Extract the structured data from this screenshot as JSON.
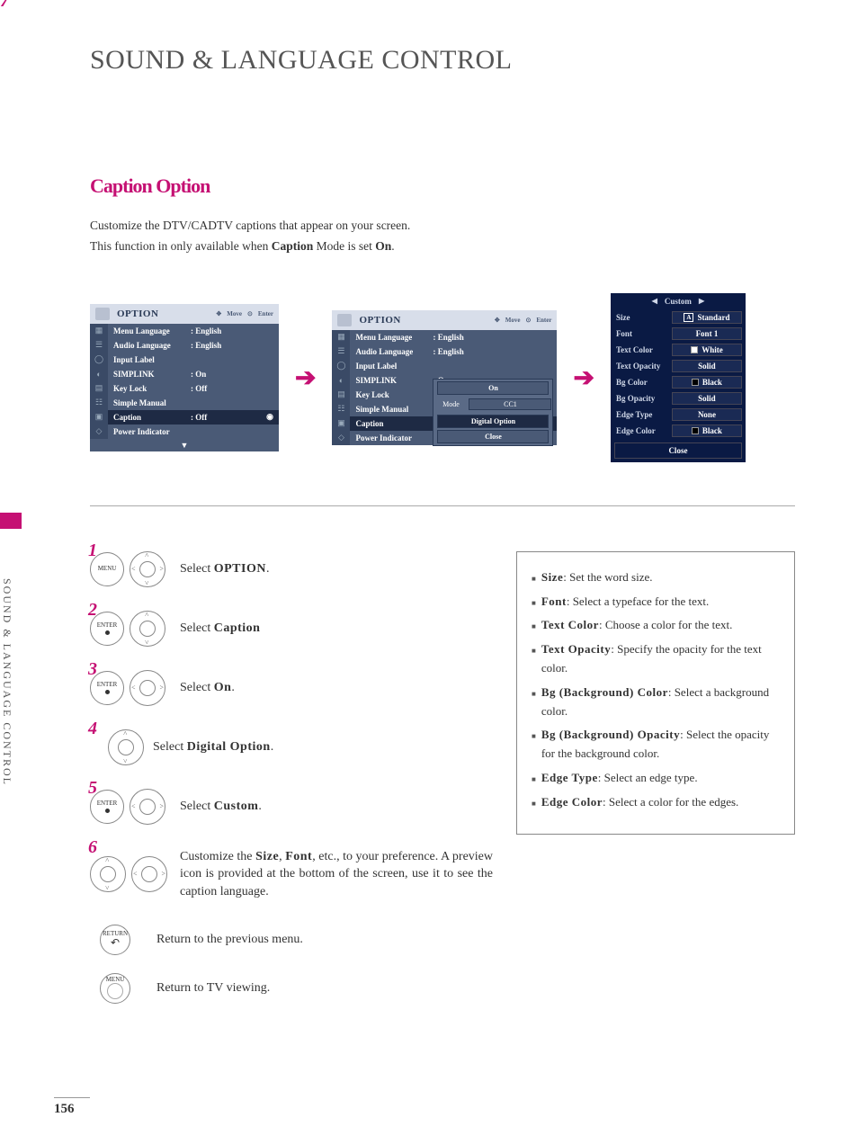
{
  "page": {
    "number": "156",
    "main_title": "SOUND & LANGUAGE CONTROL",
    "side_tab": "SOUND & LANGUAGE CONTROL",
    "section_title": "Caption Option",
    "intro_line1": "Customize the DTV/CADTV captions that appear on your screen.",
    "intro_line2_a": "This function in only available when ",
    "intro_line2_b1": "Caption",
    "intro_line2_c": " Mode is set ",
    "intro_line2_b2": "On",
    "intro_line2_d": "."
  },
  "osd": {
    "header_label": "OPTION",
    "header_hint_move": "Move",
    "header_hint_enter": "Enter",
    "items": [
      {
        "label": "Menu Language",
        "value": ": English"
      },
      {
        "label": "Audio Language",
        "value": ": English"
      },
      {
        "label": "Input Label",
        "value": ""
      },
      {
        "label": "SIMPLINK",
        "value": ": On"
      },
      {
        "label": "Key Lock",
        "value": ": Off"
      },
      {
        "label": "Simple Manual",
        "value": ""
      },
      {
        "label": "Caption",
        "value": ": Off"
      },
      {
        "label": "Power Indicator",
        "value": ""
      }
    ],
    "popup": {
      "mode_label": "Mode",
      "mode_value": "CC1",
      "on_value": "On",
      "digital_option": "Digital Option",
      "close": "Close"
    }
  },
  "custom": {
    "title": "Custom",
    "rows": [
      {
        "label": "Size",
        "value": "Standard",
        "swatch": null,
        "icon": "A"
      },
      {
        "label": "Font",
        "value": "Font 1",
        "swatch": null
      },
      {
        "label": "Text Color",
        "value": "White",
        "swatch": "#fff"
      },
      {
        "label": "Text Opacity",
        "value": "Solid",
        "swatch": null
      },
      {
        "label": "Bg Color",
        "value": "Black",
        "swatch": "#000"
      },
      {
        "label": "Bg Opacity",
        "value": "Solid",
        "swatch": null
      },
      {
        "label": "Edge Type",
        "value": "None",
        "swatch": null
      },
      {
        "label": "Edge Color",
        "value": "Black",
        "swatch": "#000"
      }
    ],
    "close": "Close"
  },
  "steps": {
    "s1_a": "Select ",
    "s1_b": "OPTION",
    "s1_c": ".",
    "s2_a": "Select ",
    "s2_b": "Caption",
    "s3_a": "Select ",
    "s3_b": "On",
    "s3_c": ".",
    "s4_a": "Select ",
    "s4_b": "Digital Option",
    "s4_c": ".",
    "s5_a": "Select ",
    "s5_b": "Custom",
    "s5_c": ".",
    "s6_a": "Customize the ",
    "s6_b1": "Size",
    "s6_m": ", ",
    "s6_b2": "Font",
    "s6_c": ", etc., to your preference. A preview icon is provided at the bottom of the screen, use it to see the caption language.",
    "s7": "Return to the previous menu.",
    "s8": "Return to TV viewing.",
    "btn_menu": "MENU",
    "btn_enter": "ENTER",
    "btn_return": "RETURN"
  },
  "descriptions": {
    "items": [
      {
        "b": "Size",
        "t": ": Set the word size."
      },
      {
        "b": "Font",
        "t": ": Select a typeface for the text."
      },
      {
        "b": "Text Color",
        "t": ": Choose a color for the text."
      },
      {
        "b": "Text Opacity",
        "t": ": Specify the opacity for the text color."
      },
      {
        "b": "Bg (Background) Color",
        "t": ": Select a background color."
      },
      {
        "b": "Bg (Background) Opacity",
        "t": ": Select the opacity for the background color."
      },
      {
        "b": "Edge Type",
        "t": ": Select an edge type."
      },
      {
        "b": "Edge Color",
        "t": ": Select a color for the edges."
      }
    ]
  }
}
